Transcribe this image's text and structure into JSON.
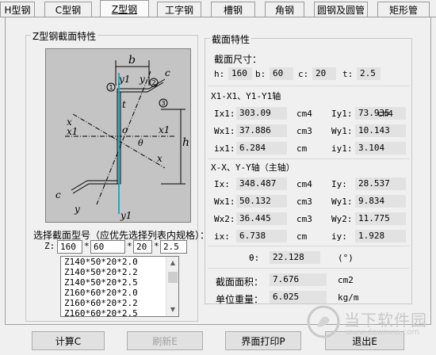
{
  "tabs": [
    {
      "label": "H型钢"
    },
    {
      "label": "C型钢"
    },
    {
      "label": "Z型钢"
    },
    {
      "label": "工字钢"
    },
    {
      "label": "槽钢"
    },
    {
      "label": "角钢"
    },
    {
      "label": "圆钢及圆管"
    },
    {
      "label": "矩形管"
    }
  ],
  "left_group": {
    "title": "Z型钢截面特性",
    "diagram_labels": {
      "b": "b",
      "y1_top": "y1",
      "y_top": "y",
      "c": "c",
      "t": "t",
      "x_left": "x",
      "x1_left": "x1",
      "o": "o",
      "x1_right": "x1",
      "theta": "θ",
      "x_right": "x",
      "h": "h",
      "c_bottom": "c",
      "y_bottom": "y",
      "y1_bottom": "y1",
      "n1": "1",
      "n2": "2",
      "n3": "3"
    },
    "select_label": "选择截面型号（应优先选择列表内规格）：",
    "z_label": "Z:",
    "inputs": [
      "160",
      "60",
      "20",
      "2.5"
    ],
    "separator": "*",
    "list_items": [
      "Z140*50*20*2.0",
      "Z140*50*20*2.2",
      "Z140*50*20*2.5",
      "Z160*60*20*2.0",
      "Z160*60*20*2.2",
      "Z160*60*20*2.5"
    ]
  },
  "right_group": {
    "title": "截面特性",
    "size_title": "截面尺寸：",
    "dims": [
      {
        "label": "h:",
        "value": "160"
      },
      {
        "label": "b:",
        "value": "60"
      },
      {
        "label": "c:",
        "value": "20"
      },
      {
        "label": "t:",
        "value": "2.5"
      }
    ],
    "section1_title": "X1-X1、Y1-Y1轴",
    "section1": [
      {
        "l": "Ix1:",
        "v": "303.09",
        "u": "cm4",
        "l2": "Iy1:",
        "v2": "73.935",
        "u2": "cm4"
      },
      {
        "l": "Wx1:",
        "v": "37.886",
        "u": "cm3",
        "l2": "Wy1:",
        "v2": "10.143",
        "u2": "cm3"
      },
      {
        "l": "ix1:",
        "v": "6.284",
        "u": "cm",
        "l2": "iy1:",
        "v2": "3.104",
        "u2": "cm"
      }
    ],
    "section2_title": "X-X、Y-Y轴（主轴）",
    "section2": [
      {
        "l": "Ix:",
        "v": "348.487",
        "u": "cm4",
        "l2": "Iy:",
        "v2": "28.537",
        "u2": "cm4"
      },
      {
        "l": "Wx1:",
        "v": "50.132",
        "u": "cm3",
        "l2": "Wy1:",
        "v2": "9.834",
        "u2": "cm3"
      },
      {
        "l": "Wx2:",
        "v": "36.445",
        "u": "cm3",
        "l2": "Wy2:",
        "v2": "11.775",
        "u2": "cm3"
      },
      {
        "l": "ix:",
        "v": "6.738",
        "u": "cm",
        "l2": "iy:",
        "v2": "1.928",
        "u2": "cm"
      }
    ],
    "theta": {
      "label": "θ:",
      "value": "22.128",
      "unit": "(°)"
    },
    "area": {
      "label": "截面面积：",
      "value": "7.676",
      "unit": "cm2"
    },
    "weight": {
      "label": "单位重量：",
      "value": "6.025",
      "unit": "kg/m"
    }
  },
  "buttons": {
    "calc": "计算C",
    "refresh": "刷新E",
    "print": "界面打印P",
    "exit": "退出E"
  },
  "watermark": {
    "title": "当下软件园",
    "url": "www.downxia.com"
  },
  "colors": {
    "accent": "#2aa8b8",
    "diagram_bg": "#c4c4c4"
  }
}
